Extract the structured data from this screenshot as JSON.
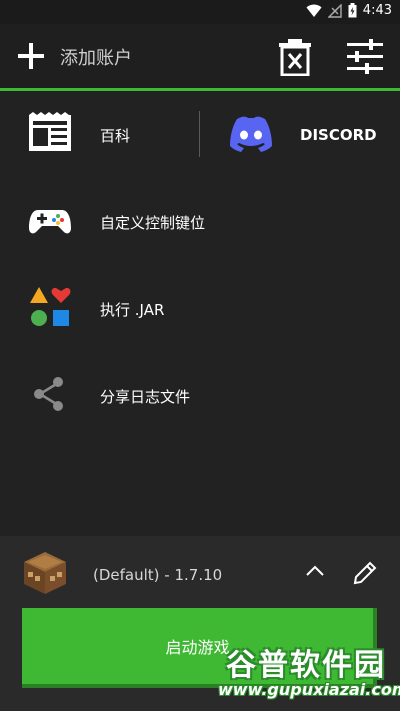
{
  "status_bar": {
    "time": "4:43"
  },
  "header": {
    "add_account_label": "添加账户"
  },
  "menu": {
    "wiki_label": "百科",
    "discord_label": "DISCORD",
    "custom_controls_label": "自定义控制键位",
    "execute_jar_label": "执行 .JAR",
    "share_logs_label": "分享日志文件"
  },
  "profile": {
    "label": "(Default) - 1.7.10"
  },
  "launch": {
    "label": "启动游戏"
  },
  "watermark": {
    "title": "谷普软件园",
    "url": "www.gupuxiazai.com"
  },
  "colors": {
    "accent": "#3fb833",
    "discord": "#5865f2"
  }
}
